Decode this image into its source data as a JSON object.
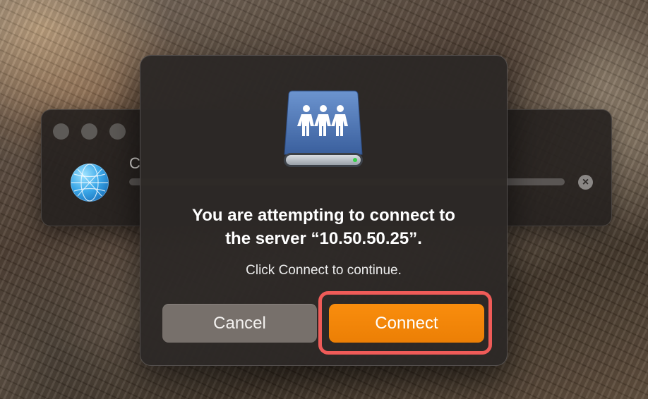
{
  "background_window": {
    "partial_title_letter": "C",
    "icon": "network-globe-icon",
    "close_icon": "close-circle-icon",
    "close_glyph": "×"
  },
  "dialog": {
    "icon": "shared-server-icon",
    "heading_line1": "You are attempting to connect to",
    "heading_line2": "the server “10.50.50.25”.",
    "message": "Click Connect to continue.",
    "cancel_label": "Cancel",
    "connect_label": "Connect"
  },
  "colors": {
    "accent": "#f98d0d",
    "highlight": "#ef5b58",
    "cancel_button": "#77706b",
    "dialog_bg": "#2c2826"
  }
}
